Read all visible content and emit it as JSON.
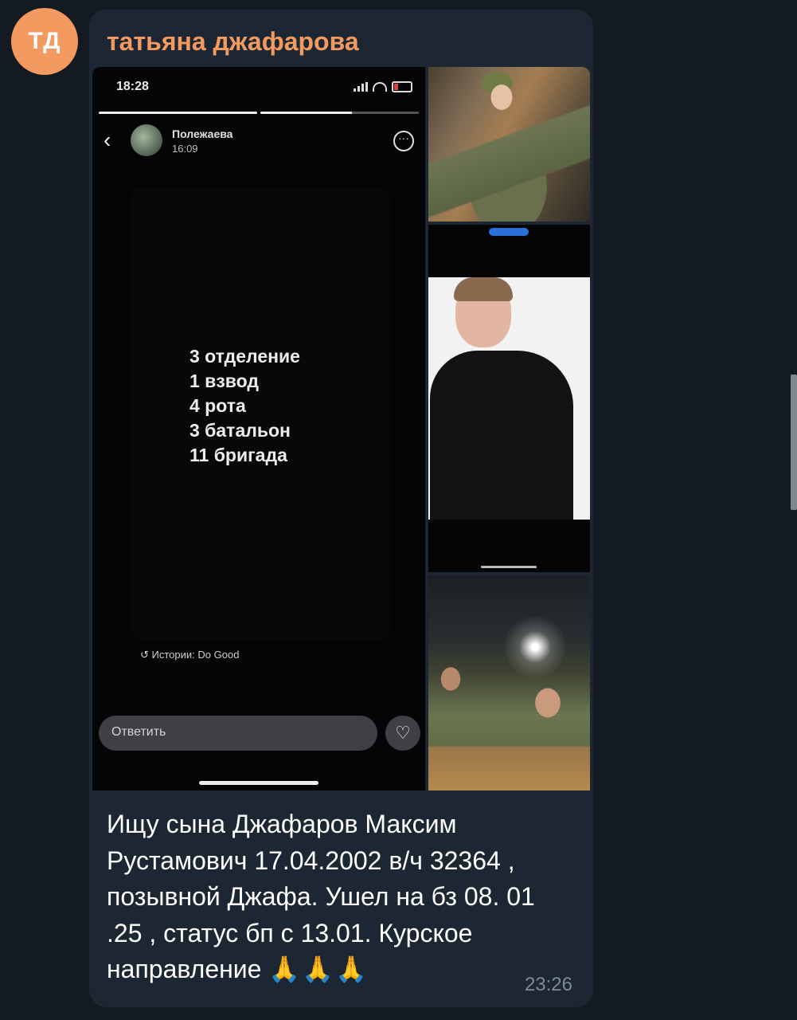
{
  "sender": {
    "initials": "ТД",
    "name": "татьяна джафарова"
  },
  "story": {
    "status_time": "18:28",
    "progress": [
      1.0,
      0.58
    ],
    "username": "Полежаева",
    "post_time": "16:09",
    "lines": [
      "3 отделение",
      "1 взвод",
      "4 рота",
      "3 батальон",
      "11 бригада"
    ],
    "credit": "Истории: Do Good",
    "reply_placeholder": "Ответить"
  },
  "message": {
    "caption": "Ищу сына Джафаров Максим Рустамович 17.04.2002 в/ч 32364 , позывной Джафа. Ушел на бз 08. 01 .25 , статус бп с 13.01. Курское направление",
    "emoji": "🙏🙏🙏",
    "time": "23:26"
  },
  "icons": {
    "back": "chevron-left-icon",
    "more": "more-icon",
    "heart": "heart-icon",
    "signal": "signal-icon",
    "wifi": "wifi-icon",
    "battery": "battery-icon"
  },
  "colors": {
    "background": "#141a22",
    "bubble": "#1d2733",
    "accent": "#f29a5f",
    "timestamp": "#7e8a97"
  }
}
